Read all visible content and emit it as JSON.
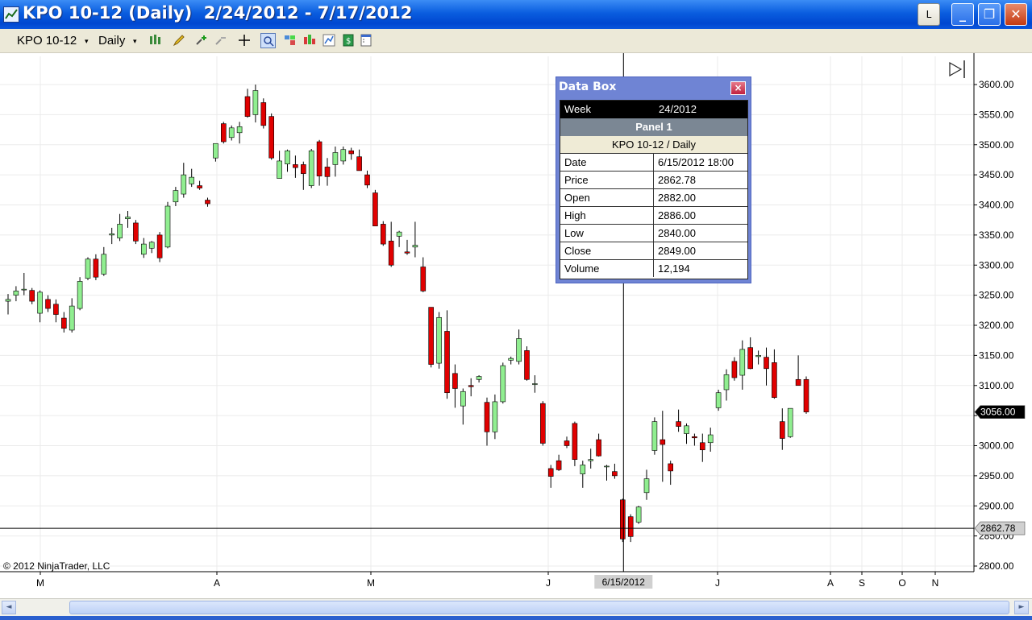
{
  "window": {
    "title": "KPO 10-12 (Daily)  2/24/2012 - 7/17/2012",
    "btn_l": "L",
    "btn_min": "_",
    "btn_max": "❐",
    "btn_close": "✕"
  },
  "toolbar": {
    "instrument": "KPO 10-12",
    "interval": "Daily",
    "dropdown_glyph": "▾",
    "icons": [
      "candlestick-style-icon",
      "drawing-pencil-icon",
      "add-indicator-icon",
      "remove-indicator-icon",
      "crosshair-icon",
      "data-box-icon",
      "strategies-icon",
      "chart-style-icon",
      "chart-properties-icon",
      "order-icon",
      "properties-icon"
    ]
  },
  "colors": {
    "up_candle": "#90ee90",
    "down_candle": "#e00000",
    "grid": "#ebebeb",
    "crosshair": "#000000"
  },
  "chart_data": {
    "type": "candlestick",
    "title": "KPO 10-12 (Daily)",
    "copyright": "© 2012 NinjaTrader, LLC",
    "ylim": [
      2790,
      3625
    ],
    "y_ticks": [
      "3600.00",
      "3550.00",
      "3500.00",
      "3450.00",
      "3400.00",
      "3350.00",
      "3300.00",
      "3250.00",
      "3200.00",
      "3150.00",
      "3100.00",
      "3050.00",
      "3000.00",
      "2950.00",
      "2900.00",
      "2850.00",
      "2800.00"
    ],
    "x_ticks": [
      "M",
      "A",
      "M",
      "J",
      "J",
      "A",
      "S",
      "O",
      "N"
    ],
    "current_price_label": "3056.00",
    "crosshair_price_label": "2862.78",
    "crosshair_date_label": "6/15/2012",
    "crosshair_price": 2862.78,
    "crosshair_bar_index": 77,
    "candles": [
      {
        "o": 3240,
        "h": 3252,
        "l": 3218,
        "c": 3243
      },
      {
        "o": 3250,
        "h": 3265,
        "l": 3240,
        "c": 3257
      },
      {
        "o": 3259,
        "h": 3287,
        "l": 3250,
        "c": 3260
      },
      {
        "o": 3258,
        "h": 3262,
        "l": 3235,
        "c": 3240
      },
      {
        "o": 3220,
        "h": 3258,
        "l": 3205,
        "c": 3255
      },
      {
        "o": 3243,
        "h": 3250,
        "l": 3222,
        "c": 3228
      },
      {
        "o": 3235,
        "h": 3243,
        "l": 3205,
        "c": 3218
      },
      {
        "o": 3212,
        "h": 3222,
        "l": 3188,
        "c": 3195
      },
      {
        "o": 3192,
        "h": 3245,
        "l": 3188,
        "c": 3232
      },
      {
        "o": 3228,
        "h": 3280,
        "l": 3225,
        "c": 3273
      },
      {
        "o": 3278,
        "h": 3313,
        "l": 3275,
        "c": 3310
      },
      {
        "o": 3310,
        "h": 3318,
        "l": 3275,
        "c": 3280
      },
      {
        "o": 3285,
        "h": 3330,
        "l": 3282,
        "c": 3318
      },
      {
        "o": 3350,
        "h": 3362,
        "l": 3335,
        "c": 3352
      },
      {
        "o": 3345,
        "h": 3385,
        "l": 3340,
        "c": 3368
      },
      {
        "o": 3377,
        "h": 3390,
        "l": 3362,
        "c": 3380
      },
      {
        "o": 3370,
        "h": 3375,
        "l": 3335,
        "c": 3340
      },
      {
        "o": 3318,
        "h": 3345,
        "l": 3312,
        "c": 3335
      },
      {
        "o": 3328,
        "h": 3340,
        "l": 3320,
        "c": 3338
      },
      {
        "o": 3350,
        "h": 3355,
        "l": 3305,
        "c": 3312
      },
      {
        "o": 3330,
        "h": 3405,
        "l": 3328,
        "c": 3398
      },
      {
        "o": 3405,
        "h": 3430,
        "l": 3398,
        "c": 3424
      },
      {
        "o": 3418,
        "h": 3470,
        "l": 3412,
        "c": 3450
      },
      {
        "o": 3435,
        "h": 3460,
        "l": 3430,
        "c": 3446
      },
      {
        "o": 3432,
        "h": 3440,
        "l": 3425,
        "c": 3428
      },
      {
        "o": 3408,
        "h": 3412,
        "l": 3397,
        "c": 3402
      },
      {
        "o": 3478,
        "h": 3502,
        "l": 3472,
        "c": 3502
      },
      {
        "o": 3535,
        "h": 3538,
        "l": 3502,
        "c": 3505
      },
      {
        "o": 3512,
        "h": 3532,
        "l": 3507,
        "c": 3528
      },
      {
        "o": 3520,
        "h": 3538,
        "l": 3502,
        "c": 3530
      },
      {
        "o": 3580,
        "h": 3593,
        "l": 3545,
        "c": 3547
      },
      {
        "o": 3550,
        "h": 3600,
        "l": 3537,
        "c": 3590
      },
      {
        "o": 3570,
        "h": 3577,
        "l": 3527,
        "c": 3532
      },
      {
        "o": 3547,
        "h": 3552,
        "l": 3475,
        "c": 3478
      },
      {
        "o": 3444,
        "h": 3490,
        "l": 3444,
        "c": 3473
      },
      {
        "o": 3468,
        "h": 3492,
        "l": 3455,
        "c": 3490
      },
      {
        "o": 3467,
        "h": 3482,
        "l": 3445,
        "c": 3462
      },
      {
        "o": 3467,
        "h": 3472,
        "l": 3425,
        "c": 3452
      },
      {
        "o": 3432,
        "h": 3493,
        "l": 3428,
        "c": 3490
      },
      {
        "o": 3505,
        "h": 3508,
        "l": 3432,
        "c": 3448
      },
      {
        "o": 3463,
        "h": 3478,
        "l": 3432,
        "c": 3447
      },
      {
        "o": 3467,
        "h": 3497,
        "l": 3447,
        "c": 3487
      },
      {
        "o": 3473,
        "h": 3497,
        "l": 3467,
        "c": 3492
      },
      {
        "o": 3490,
        "h": 3495,
        "l": 3475,
        "c": 3485
      },
      {
        "o": 3480,
        "h": 3492,
        "l": 3457,
        "c": 3457
      },
      {
        "o": 3450,
        "h": 3457,
        "l": 3428,
        "c": 3433
      },
      {
        "o": 3420,
        "h": 3425,
        "l": 3368,
        "c": 3365
      },
      {
        "o": 3368,
        "h": 3373,
        "l": 3332,
        "c": 3335
      },
      {
        "o": 3340,
        "h": 3372,
        "l": 3297,
        "c": 3300
      },
      {
        "o": 3348,
        "h": 3357,
        "l": 3330,
        "c": 3355
      },
      {
        "o": 3322,
        "h": 3342,
        "l": 3317,
        "c": 3320
      },
      {
        "o": 3330,
        "h": 3372,
        "l": 3313,
        "c": 3333
      },
      {
        "o": 3297,
        "h": 3313,
        "l": 3255,
        "c": 3257
      },
      {
        "o": 3230,
        "h": 3230,
        "l": 3130,
        "c": 3135
      },
      {
        "o": 3137,
        "h": 3222,
        "l": 3128,
        "c": 3213
      },
      {
        "o": 3190,
        "h": 3225,
        "l": 3078,
        "c": 3088
      },
      {
        "o": 3120,
        "h": 3135,
        "l": 3063,
        "c": 3095
      },
      {
        "o": 3066,
        "h": 3095,
        "l": 3035,
        "c": 3090
      },
      {
        "o": 3100,
        "h": 3112,
        "l": 3082,
        "c": 3098
      },
      {
        "o": 3110,
        "h": 3117,
        "l": 3105,
        "c": 3115
      },
      {
        "o": 3072,
        "h": 3080,
        "l": 3000,
        "c": 3023
      },
      {
        "o": 3023,
        "h": 3085,
        "l": 3011,
        "c": 3073
      },
      {
        "o": 3073,
        "h": 3138,
        "l": 3070,
        "c": 3133
      },
      {
        "o": 3142,
        "h": 3148,
        "l": 3135,
        "c": 3145
      },
      {
        "o": 3140,
        "h": 3193,
        "l": 3135,
        "c": 3178
      },
      {
        "o": 3158,
        "h": 3165,
        "l": 3108,
        "c": 3110
      },
      {
        "o": 3102,
        "h": 3117,
        "l": 3088,
        "c": 3103
      },
      {
        "o": 3070,
        "h": 3074,
        "l": 3000,
        "c": 3004
      },
      {
        "o": 2962,
        "h": 2968,
        "l": 2930,
        "c": 2949
      },
      {
        "o": 2975,
        "h": 2985,
        "l": 2958,
        "c": 2960
      },
      {
        "o": 3008,
        "h": 3015,
        "l": 2996,
        "c": 3000
      },
      {
        "o": 3037,
        "h": 3040,
        "l": 2966,
        "c": 2977
      },
      {
        "o": 2953,
        "h": 2975,
        "l": 2930,
        "c": 2968
      },
      {
        "o": 2975,
        "h": 2995,
        "l": 2962,
        "c": 2977
      },
      {
        "o": 3010,
        "h": 3020,
        "l": 2982,
        "c": 2983
      },
      {
        "o": 2965,
        "h": 2968,
        "l": 2942,
        "c": 2966
      },
      {
        "o": 2957,
        "h": 2970,
        "l": 2945,
        "c": 2950
      },
      {
        "o": 2910,
        "h": 2912,
        "l": 2840,
        "c": 2845
      },
      {
        "o": 2882,
        "h": 2886,
        "l": 2840,
        "c": 2849
      },
      {
        "o": 2873,
        "h": 2900,
        "l": 2870,
        "c": 2898
      },
      {
        "o": 2922,
        "h": 2960,
        "l": 2910,
        "c": 2945
      },
      {
        "o": 2992,
        "h": 3047,
        "l": 2985,
        "c": 3040
      },
      {
        "o": 3010,
        "h": 3058,
        "l": 2940,
        "c": 3002
      },
      {
        "o": 2970,
        "h": 2975,
        "l": 2935,
        "c": 2958
      },
      {
        "o": 3040,
        "h": 3060,
        "l": 3023,
        "c": 3032
      },
      {
        "o": 3020,
        "h": 3037,
        "l": 3003,
        "c": 3033
      },
      {
        "o": 3015,
        "h": 3020,
        "l": 3000,
        "c": 3013
      },
      {
        "o": 3005,
        "h": 3020,
        "l": 2973,
        "c": 2993
      },
      {
        "o": 3005,
        "h": 3030,
        "l": 2990,
        "c": 3018
      },
      {
        "o": 3063,
        "h": 3093,
        "l": 3058,
        "c": 3088
      },
      {
        "o": 3093,
        "h": 3127,
        "l": 3075,
        "c": 3118
      },
      {
        "o": 3140,
        "h": 3147,
        "l": 3108,
        "c": 3113
      },
      {
        "o": 3117,
        "h": 3175,
        "l": 3093,
        "c": 3160
      },
      {
        "o": 3163,
        "h": 3180,
        "l": 3127,
        "c": 3128
      },
      {
        "o": 3148,
        "h": 3158,
        "l": 3135,
        "c": 3150
      },
      {
        "o": 3147,
        "h": 3163,
        "l": 3100,
        "c": 3128
      },
      {
        "o": 3138,
        "h": 3160,
        "l": 3078,
        "c": 3080
      },
      {
        "o": 3040,
        "h": 3062,
        "l": 2993,
        "c": 3012
      },
      {
        "o": 3015,
        "h": 3062,
        "l": 3013,
        "c": 3062
      },
      {
        "o": 3110,
        "h": 3150,
        "l": 3105,
        "c": 3100
      },
      {
        "o": 3110,
        "h": 3115,
        "l": 3053,
        "c": 3056
      }
    ]
  },
  "databox": {
    "title": "Data Box",
    "close_glyph": "×",
    "week_label": "Week",
    "week_value": "24/2012",
    "panel": "Panel 1",
    "series": "KPO 10-12 / Daily",
    "rows": [
      {
        "k": "Date",
        "v": "6/15/2012 18:00"
      },
      {
        "k": "Price",
        "v": "2862.78"
      },
      {
        "k": "Open",
        "v": "2882.00"
      },
      {
        "k": "High",
        "v": "2886.00"
      },
      {
        "k": "Low",
        "v": "2840.00"
      },
      {
        "k": "Close",
        "v": "2849.00"
      },
      {
        "k": "Volume",
        "v": "12,194"
      }
    ]
  },
  "scroll": {
    "left_glyph": "◄",
    "right_glyph": "►"
  }
}
